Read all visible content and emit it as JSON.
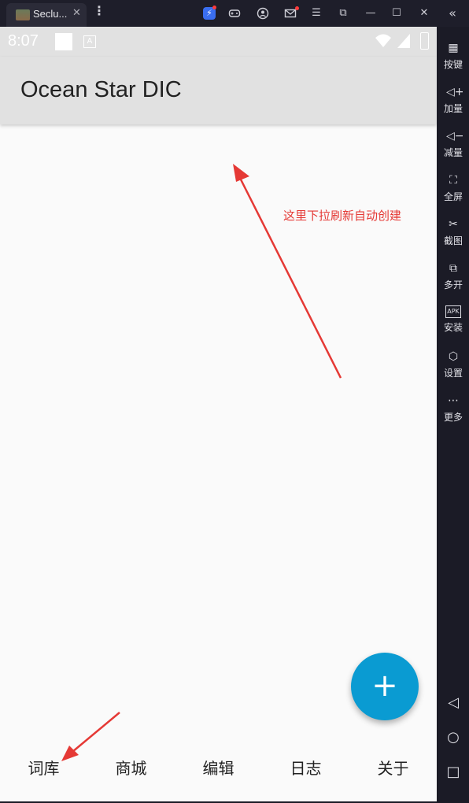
{
  "window": {
    "tab_title": "Seclu...",
    "tab_close": "✕",
    "menu_glyph": "⋮",
    "controls": {
      "boost": "⚡",
      "gamepad": "🎮",
      "account": "◉",
      "mail": "✉",
      "menu": "☰",
      "popout": "⧉",
      "minimize": "—",
      "maximize": "☐",
      "close": "✕",
      "collapse": "«"
    }
  },
  "status": {
    "time": "8:07",
    "a_badge": "A"
  },
  "app": {
    "title": "Ocean Star DIC",
    "annotation": "这里下拉刷新自动创建",
    "fab_label": "+",
    "nav": [
      "词库",
      "商城",
      "编辑",
      "日志",
      "关于"
    ]
  },
  "side_panel": {
    "items": [
      {
        "label": "按键",
        "icon": "keyboard-icon",
        "glyph": "▦"
      },
      {
        "label": "加量",
        "icon": "volume-up-icon",
        "glyph": "◁+"
      },
      {
        "label": "减量",
        "icon": "volume-down-icon",
        "glyph": "◁−"
      },
      {
        "label": "全屏",
        "icon": "fullscreen-icon",
        "glyph": "⛶"
      },
      {
        "label": "截图",
        "icon": "scissors-icon",
        "glyph": "✂"
      },
      {
        "label": "多开",
        "icon": "multi-instance-icon",
        "glyph": "⧉"
      },
      {
        "label": "安装",
        "icon": "apk-install-icon",
        "glyph": "APK"
      },
      {
        "label": "设置",
        "icon": "settings-icon",
        "glyph": "⬡"
      },
      {
        "label": "更多",
        "icon": "more-icon",
        "glyph": "⋯"
      }
    ],
    "system_nav": {
      "back": "◁",
      "home": "○",
      "recents": "□"
    }
  },
  "colors": {
    "accent_fab": "#0a9bd2",
    "annotation_red": "#e53935",
    "appbar": "#e1e1e1",
    "frame": "#1b1b26"
  }
}
